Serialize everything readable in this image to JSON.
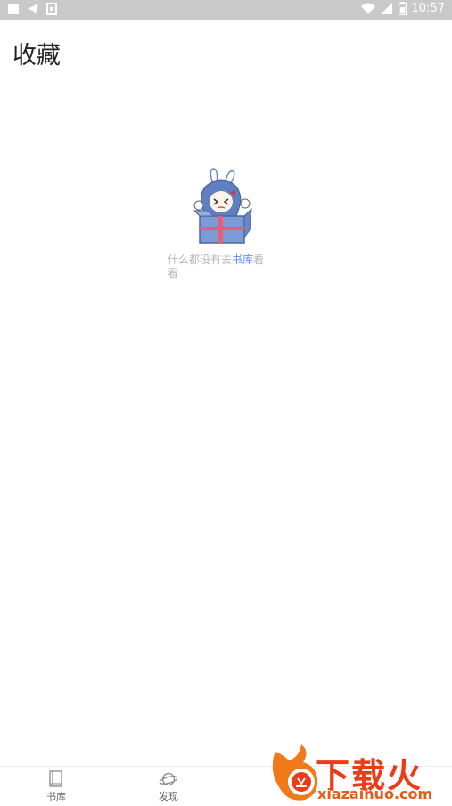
{
  "status_bar": {
    "time": "10:57",
    "icons": [
      "notification-square-icon",
      "telegram-icon",
      "image-icon",
      "wifi-icon",
      "signal-icon",
      "battery-icon"
    ]
  },
  "page": {
    "title": "收藏"
  },
  "empty_state": {
    "text_before": "什么都没有去",
    "link_text": "书库",
    "text_after": "看看",
    "link_color": "#5b8fe4",
    "text_color": "#b7b7b7"
  },
  "bottom_nav": {
    "items": [
      {
        "label": "书库",
        "icon": "book-icon"
      },
      {
        "label": "发现",
        "icon": "planet-icon"
      }
    ]
  },
  "watermark": {
    "title": "下载火",
    "subtitle": "xiazaihuo.com"
  }
}
